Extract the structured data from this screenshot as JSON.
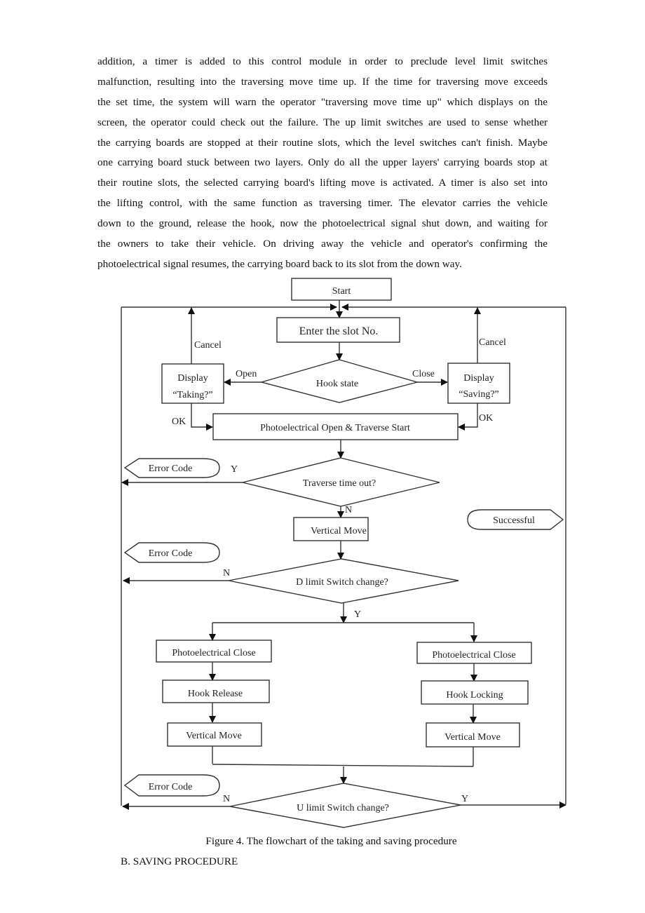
{
  "body_text": {
    "lines": [
      "addition, a timer is added to this control module in order to preclude level limit switches",
      "malfunction, resulting into the traversing move time up. If the time for traversing move exceeds",
      "the set time, the system will warn the operator \"traversing move time up\" which displays on the",
      "screen, the operator could check out the failure. The up limit switches are used to sense whether",
      "the carrying boards are stopped at their routine slots, which the level switches can't finish. Maybe",
      "one carrying board stuck between two layers. Only do all the upper layers' carrying boards stop at",
      "their routine slots, the selected carrying board's lifting move is activated. A timer is also set into",
      "the lifting control, with the same function as traversing timer. The elevator carries the vehicle",
      "down to the ground, release the hook, now the photoelectrical signal shut down, and waiting for",
      "the owners to take their vehicle. On driving away the vehicle and operator's confirming the",
      "photoelectrical signal resumes, the carrying board back to its slot from the down way."
    ]
  },
  "flowchart": {
    "start": "Start",
    "enter_slot": "Enter the slot No.",
    "hook_state": "Hook state",
    "open_label": "Open",
    "close_label": "Close",
    "display_taking_1": "Display",
    "display_taking_2": "“Taking?”",
    "display_saving_1": "Display",
    "display_saving_2": "“Saving?”",
    "cancel_left": "Cancel",
    "cancel_right": "Cancel",
    "ok_left": "OK",
    "ok_right": "OK",
    "photo_open": "Photoelectrical  Open & Traverse Start",
    "error_code_1": "Error Code",
    "y_label_1": "Y",
    "traverse_timeout": "Traverse time out?",
    "n_label_1": "N",
    "vertical_move_1": "Vertical Move",
    "successful": "Successful",
    "error_code_2": "Error Code",
    "n_label_2": "N",
    "d_limit": "D limit Switch change?",
    "y_label_2": "Y",
    "photo_close_left": "Photoelectrical  Close",
    "photo_close_right": "Photoelectrical  Close",
    "hook_release": "Hook Release",
    "hook_locking": "Hook Locking",
    "vertical_move_left": "Vertical Move",
    "vertical_move_right": "Vertical Move",
    "error_code_3": "Error Code",
    "n_label_3": "N",
    "y_label_3": "Y",
    "u_limit": "U limit Switch change?"
  },
  "caption": "Figure 4. The flowchart of the taking and saving procedure",
  "section_heading": "B. SAVING PROCEDURE"
}
